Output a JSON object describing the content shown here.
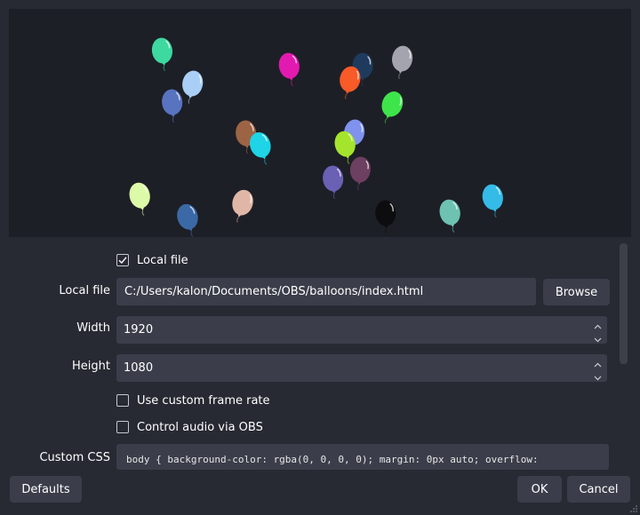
{
  "preview": {
    "balloons": [
      {
        "color": "#3dd9a0"
      },
      {
        "color": "#a9cff6"
      },
      {
        "color": "#5874c0"
      },
      {
        "color": "#e31ab0"
      },
      {
        "color": "#1e3b5e"
      },
      {
        "color": "#f85a28"
      },
      {
        "color": "#a4a4ae"
      },
      {
        "color": "#3de44a"
      },
      {
        "color": "#9c6445"
      },
      {
        "color": "#1ed4e6"
      },
      {
        "color": "#7f92ee"
      },
      {
        "color": "#a5e42d"
      },
      {
        "color": "#6d3f60"
      },
      {
        "color": "#6a60b4"
      },
      {
        "color": "#dcfaa8"
      },
      {
        "color": "#3b69a6"
      },
      {
        "color": "#e0b7a6"
      },
      {
        "color": "#0d0d0f"
      },
      {
        "color": "#6dc2b2"
      },
      {
        "color": "#35bbe8"
      }
    ]
  },
  "form": {
    "local_file_checkbox": {
      "label": "Local file",
      "checked": true
    },
    "local_file": {
      "label": "Local file",
      "value": "C:/Users/kalon/Documents/OBS/balloons/index.html",
      "browse_label": "Browse"
    },
    "width": {
      "label": "Width",
      "value": "1920"
    },
    "height": {
      "label": "Height",
      "value": "1080"
    },
    "custom_frame_rate": {
      "label": "Use custom frame rate",
      "checked": false
    },
    "control_audio": {
      "label": "Control audio via OBS",
      "checked": false
    },
    "custom_css": {
      "label": "Custom CSS",
      "value": "body { background-color: rgba(0, 0, 0, 0); margin: 0px auto; overflow:"
    }
  },
  "footer": {
    "defaults_label": "Defaults",
    "ok_label": "OK",
    "cancel_label": "Cancel"
  },
  "colors": {
    "window_bg": "#272a33",
    "preview_bg": "#1d1f26",
    "field_bg": "#3b3e4a",
    "text": "#ffffff"
  }
}
